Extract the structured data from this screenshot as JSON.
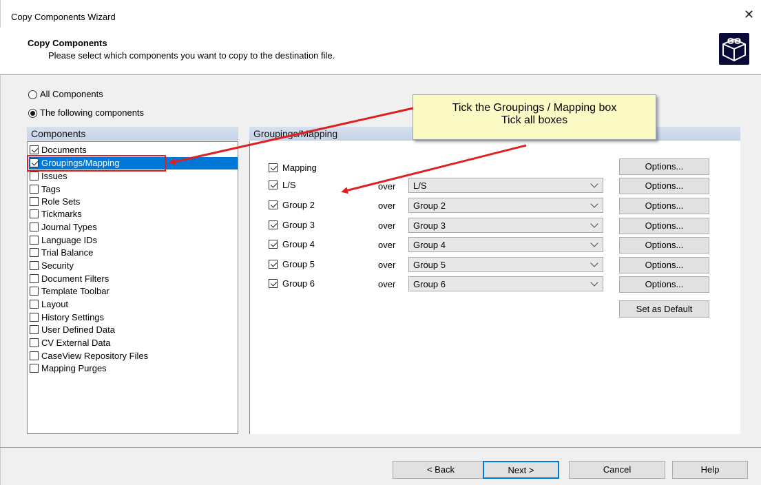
{
  "window": {
    "title": "Copy Components Wizard"
  },
  "header": {
    "title": "Copy Components",
    "description": "Please select which components you want to copy to the destination file."
  },
  "selection": {
    "all_label": "All Components",
    "following_label": "The following components",
    "selected": "following"
  },
  "components_panel": {
    "header": "Components",
    "items": [
      {
        "label": "Documents",
        "checked": true
      },
      {
        "label": "Groupings/Mapping",
        "checked": true,
        "selected": true
      },
      {
        "label": "Issues",
        "checked": false
      },
      {
        "label": "Tags",
        "checked": false
      },
      {
        "label": "Role Sets",
        "checked": false
      },
      {
        "label": "Tickmarks",
        "checked": false
      },
      {
        "label": "Journal Types",
        "checked": false
      },
      {
        "label": "Language IDs",
        "checked": false
      },
      {
        "label": "Trial Balance",
        "checked": false
      },
      {
        "label": "Security",
        "checked": false
      },
      {
        "label": "Document Filters",
        "checked": false
      },
      {
        "label": "Template Toolbar",
        "checked": false
      },
      {
        "label": "Layout",
        "checked": false
      },
      {
        "label": "History Settings",
        "checked": false
      },
      {
        "label": "User Defined Data",
        "checked": false
      },
      {
        "label": "CV External Data",
        "checked": false
      },
      {
        "label": "CaseView Repository Files",
        "checked": false
      },
      {
        "label": "Mapping Purges",
        "checked": false
      }
    ]
  },
  "mapping_panel": {
    "header": "Groupings/Mapping",
    "mapping": {
      "label": "Mapping",
      "checked": true,
      "options_label": "Options..."
    },
    "over_label": "over",
    "rows": [
      {
        "label": "L/S",
        "checked": true,
        "value": "L/S",
        "options_label": "Options..."
      },
      {
        "label": "Group 2",
        "checked": true,
        "value": "Group 2",
        "options_label": "Options..."
      },
      {
        "label": "Group 3",
        "checked": true,
        "value": "Group 3",
        "options_label": "Options..."
      },
      {
        "label": "Group 4",
        "checked": true,
        "value": "Group 4",
        "options_label": "Options..."
      },
      {
        "label": "Group 5",
        "checked": true,
        "value": "Group 5",
        "options_label": "Options..."
      },
      {
        "label": "Group 6",
        "checked": true,
        "value": "Group 6",
        "options_label": "Options..."
      }
    ],
    "set_default_label": "Set as Default"
  },
  "callout": {
    "line1": "Tick the Groupings / Mapping box",
    "line2": "Tick all boxes"
  },
  "footer": {
    "back_label": "< Back",
    "next_label": "Next >",
    "cancel_label": "Cancel",
    "help_label": "Help"
  },
  "colors": {
    "selection": "#0078d7",
    "annotation_red": "#e02020",
    "header_icon_bg": "#0a0a38"
  },
  "icons": [
    "close-icon",
    "lego-cube-icon",
    "chevron-down-icon",
    "checkbox-icon",
    "radio-icon"
  ]
}
